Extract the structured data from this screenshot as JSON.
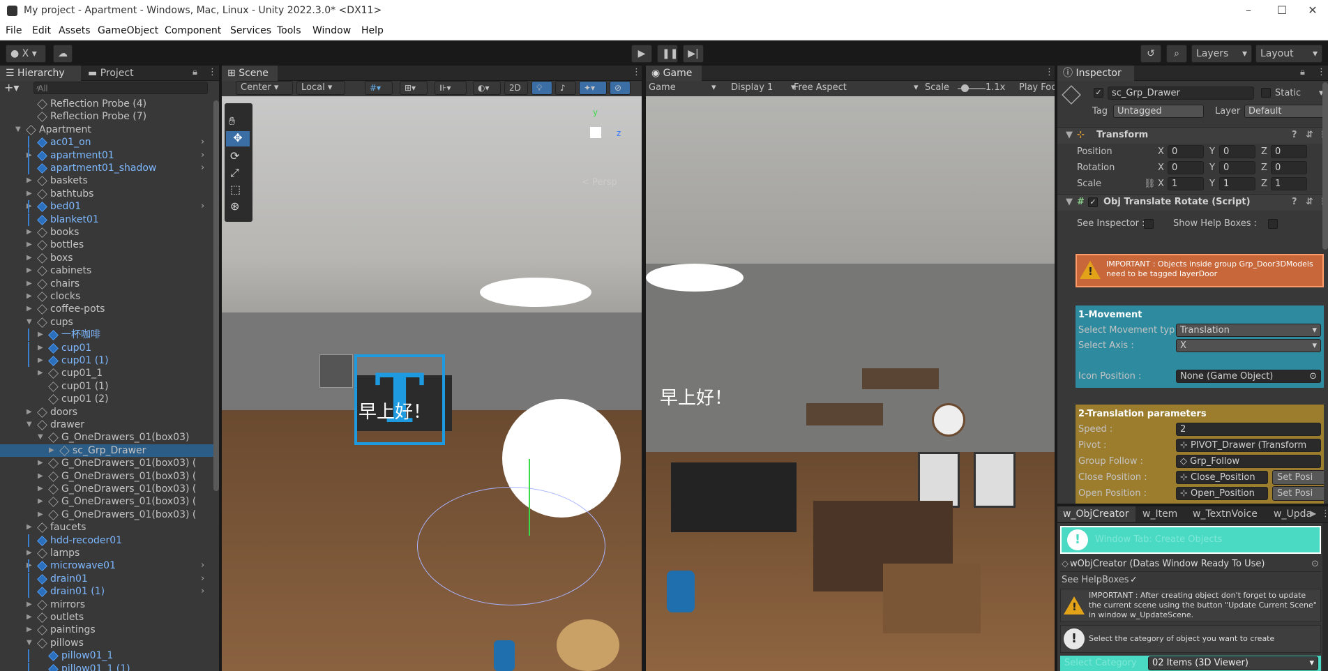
{
  "window": {
    "title": "My project - Apartment - Windows, Mac, Linux - Unity 2022.3.0* <DX11>",
    "minimize_glyph": "–",
    "maximize_glyph": "☐",
    "close_glyph": "✕"
  },
  "menu": [
    "File",
    "Edit",
    "Assets",
    "GameObject",
    "Component",
    "Services",
    "Tools",
    "Window",
    "Help"
  ],
  "toolbar": {
    "account": "X",
    "layers": "Layers",
    "layout": "Layout"
  },
  "hierarchy": {
    "tab_label": "Hierarchy",
    "project_tab_label": "Project",
    "search_placeholder": "All",
    "items": [
      {
        "label": "Reflection Probe (4)",
        "indent": 2,
        "blue": false,
        "arrow": "",
        "chev": false
      },
      {
        "label": "Reflection Probe (7)",
        "indent": 2,
        "blue": false,
        "arrow": "",
        "chev": false
      },
      {
        "label": "Apartment",
        "indent": 1,
        "blue": false,
        "arrow": "▼",
        "chev": false
      },
      {
        "label": "ac01_on",
        "indent": 2,
        "blue": true,
        "arrow": "",
        "chev": true
      },
      {
        "label": "apartment01",
        "indent": 2,
        "blue": true,
        "arrow": "▶",
        "chev": true
      },
      {
        "label": "apartment01_shadow",
        "indent": 2,
        "blue": true,
        "arrow": "",
        "chev": true
      },
      {
        "label": "baskets",
        "indent": 2,
        "blue": false,
        "arrow": "▶",
        "chev": false
      },
      {
        "label": "bathtubs",
        "indent": 2,
        "blue": false,
        "arrow": "▶",
        "chev": false
      },
      {
        "label": "bed01",
        "indent": 2,
        "blue": true,
        "arrow": "▶",
        "chev": true
      },
      {
        "label": "blanket01",
        "indent": 2,
        "blue": true,
        "arrow": "",
        "chev": false
      },
      {
        "label": "books",
        "indent": 2,
        "blue": false,
        "arrow": "▶",
        "chev": false
      },
      {
        "label": "bottles",
        "indent": 2,
        "blue": false,
        "arrow": "▶",
        "chev": false
      },
      {
        "label": "boxs",
        "indent": 2,
        "blue": false,
        "arrow": "▶",
        "chev": false
      },
      {
        "label": "cabinets",
        "indent": 2,
        "blue": false,
        "arrow": "▶",
        "chev": false
      },
      {
        "label": "chairs",
        "indent": 2,
        "blue": false,
        "arrow": "▶",
        "chev": false
      },
      {
        "label": "clocks",
        "indent": 2,
        "blue": false,
        "arrow": "▶",
        "chev": false
      },
      {
        "label": "coffee-pots",
        "indent": 2,
        "blue": false,
        "arrow": "▶",
        "chev": false
      },
      {
        "label": "cups",
        "indent": 2,
        "blue": false,
        "arrow": "▼",
        "chev": false
      },
      {
        "label": "一杯咖啡",
        "indent": 3,
        "blue": true,
        "arrow": "▶",
        "chev": false
      },
      {
        "label": "cup01",
        "indent": 3,
        "blue": true,
        "arrow": "▶",
        "chev": false
      },
      {
        "label": "cup01 (1)",
        "indent": 3,
        "blue": true,
        "arrow": "▶",
        "chev": false
      },
      {
        "label": "cup01_1",
        "indent": 3,
        "blue": false,
        "arrow": "▶",
        "chev": false
      },
      {
        "label": "cup01 (1)",
        "indent": 3,
        "blue": false,
        "arrow": "",
        "chev": false
      },
      {
        "label": "cup01 (2)",
        "indent": 3,
        "blue": false,
        "arrow": "",
        "chev": false
      },
      {
        "label": "doors",
        "indent": 2,
        "blue": false,
        "arrow": "▶",
        "chev": false
      },
      {
        "label": "drawer",
        "indent": 2,
        "blue": false,
        "arrow": "▼",
        "chev": false
      },
      {
        "label": "G_OneDrawers_01(box03)",
        "indent": 3,
        "blue": false,
        "arrow": "▼",
        "chev": false
      },
      {
        "label": "sc_Grp_Drawer",
        "indent": 4,
        "blue": false,
        "arrow": "▶",
        "chev": false,
        "selected": true
      },
      {
        "label": "G_OneDrawers_01(box03) (",
        "indent": 3,
        "blue": false,
        "arrow": "▶",
        "chev": false
      },
      {
        "label": "G_OneDrawers_01(box03) (",
        "indent": 3,
        "blue": false,
        "arrow": "▶",
        "chev": false
      },
      {
        "label": "G_OneDrawers_01(box03) (",
        "indent": 3,
        "blue": false,
        "arrow": "▶",
        "chev": false
      },
      {
        "label": "G_OneDrawers_01(box03) (",
        "indent": 3,
        "blue": false,
        "arrow": "▶",
        "chev": false
      },
      {
        "label": "G_OneDrawers_01(box03) (",
        "indent": 3,
        "blue": false,
        "arrow": "▶",
        "chev": false
      },
      {
        "label": "faucets",
        "indent": 2,
        "blue": false,
        "arrow": "▶",
        "chev": false
      },
      {
        "label": "hdd-recoder01",
        "indent": 2,
        "blue": true,
        "arrow": "",
        "chev": false
      },
      {
        "label": "lamps",
        "indent": 2,
        "blue": false,
        "arrow": "▶",
        "chev": false
      },
      {
        "label": "microwave01",
        "indent": 2,
        "blue": true,
        "arrow": "▶",
        "chev": true
      },
      {
        "label": "drain01",
        "indent": 2,
        "blue": true,
        "arrow": "",
        "chev": true
      },
      {
        "label": "drain01 (1)",
        "indent": 2,
        "blue": true,
        "arrow": "",
        "chev": true
      },
      {
        "label": "mirrors",
        "indent": 2,
        "blue": false,
        "arrow": "▶",
        "chev": false
      },
      {
        "label": "outlets",
        "indent": 2,
        "blue": false,
        "arrow": "▶",
        "chev": false
      },
      {
        "label": "paintings",
        "indent": 2,
        "blue": false,
        "arrow": "▶",
        "chev": false
      },
      {
        "label": "pillows",
        "indent": 2,
        "blue": false,
        "arrow": "▼",
        "chev": false
      },
      {
        "label": "pillow01_1",
        "indent": 3,
        "blue": true,
        "arrow": "",
        "chev": false
      },
      {
        "label": "pillow01_1 (1)",
        "indent": 3,
        "blue": true,
        "arrow": "",
        "chev": false
      }
    ]
  },
  "scene": {
    "tab_label": "Scene",
    "pivot": "Center",
    "space": "Local",
    "mode_2d": "2D",
    "persp_label": "< Persp",
    "gizmo_y": "y",
    "gizmo_z": "z",
    "overlay_text_big": "T",
    "overlay_text": "早上好！"
  },
  "game": {
    "tab_label": "Game",
    "mode": "Game",
    "display": "Display 1",
    "aspect": "Free Aspect",
    "scale_label": "Scale",
    "scale_value": "1.1x",
    "play_focus": "Play Foc",
    "overlay_text": "早上好！"
  },
  "inspector": {
    "tab_label": "Inspector",
    "object_name": "sc_Grp_Drawer",
    "static_label": "Static",
    "tag_label": "Tag",
    "tag_value": "Untagged",
    "layer_label": "Layer",
    "layer_value": "Default",
    "transform": {
      "title": "Transform",
      "rows": [
        {
          "label": "Position",
          "x": "0",
          "y": "0",
          "z": "0"
        },
        {
          "label": "Rotation",
          "x": "0",
          "y": "0",
          "z": "0"
        },
        {
          "label": "Scale",
          "x": "1",
          "y": "1",
          "z": "1"
        }
      ],
      "axis_x": "X",
      "axis_y": "Y",
      "axis_z": "Z"
    },
    "script": {
      "title": "Obj Translate Rotate (Script)",
      "see_inspector": "See Inspector :",
      "show_help": "Show Help Boxes :",
      "important": "IMPORTANT : Objects inside group Grp_Door3DModels need to be tagged layerDoor",
      "movement": {
        "title": "1-Movement",
        "select_type_label": "Select Movement typ",
        "select_type_value": "Translation",
        "select_axis_label": "Select Axis :",
        "select_axis_value": "X",
        "icon_pos_label": "Icon Position :",
        "icon_pos_value": "None (Game Object)"
      },
      "translation": {
        "title": "2-Translation parameters",
        "speed_label": "Speed :",
        "speed_value": "2",
        "pivot_label": "Pivot :",
        "pivot_value": "PIVOT_Drawer (Transform",
        "group_label": "Group Follow :",
        "group_value": "Grp_Follow",
        "close_label": "Close Position :",
        "close_value": "Close_Position",
        "open_label": "Open Position :",
        "open_value": "Open_Position",
        "set_pos": "Set Posi"
      }
    }
  },
  "bottom": {
    "tabs": [
      "w_ObjCreator",
      "w_Item",
      "w_TextnVoice",
      "w_Upda"
    ],
    "title_row": "wObjCreator (Datas Window Ready To Use)",
    "banner_text": "Window Tab: Create Objects",
    "see_helpboxes": "See HelpBoxes",
    "important": "IMPORTANT : After creating object don't forget to update the current scene using the button \"Update Current Scene\" in window w_UpdateScene.",
    "select_hint": "Select the category of object you want to create",
    "category_label": "Select Category",
    "category_value": "02 Items (3D Viewer)"
  }
}
